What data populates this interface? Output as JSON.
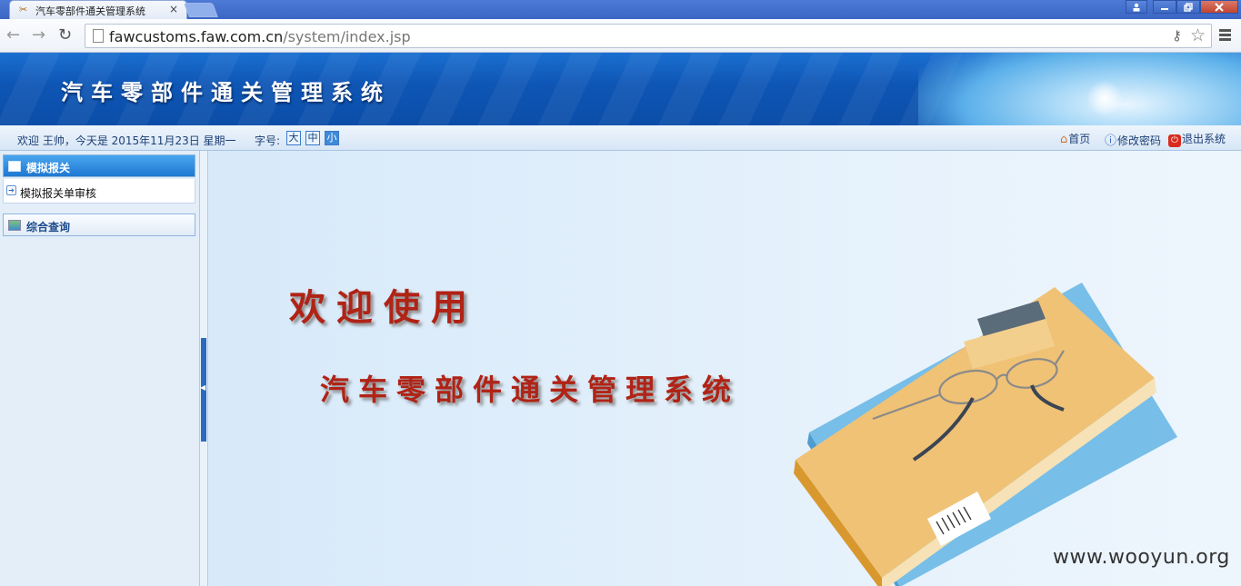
{
  "browser": {
    "tab_title": "汽车零部件通关管理系统",
    "tab_close": "×",
    "url_host": "fawcustoms.faw.com.cn",
    "url_path": "/system/index.jsp"
  },
  "app": {
    "banner_title": "汽车零部件通关管理系统",
    "welcome_text": "欢迎 王帅，今天是 2015年11月23日 星期一",
    "font_size_label": "字号:",
    "font_sizes": [
      "大",
      "中",
      "小"
    ],
    "selected_font_size": "小",
    "top_links": {
      "home": "首页",
      "change_password": "修改密码",
      "logout": "退出系统"
    }
  },
  "sidebar": {
    "menus": [
      {
        "title": "模拟报关",
        "expanded": true,
        "items": [
          "模拟报关单审核"
        ]
      },
      {
        "title": "综合查询",
        "expanded": false,
        "items": []
      }
    ]
  },
  "main": {
    "welcome_line1": "欢迎使用",
    "welcome_line2": "汽车零部件通关管理系统"
  },
  "watermark": "www.wooyun.org",
  "colors": {
    "banner": "#0e55b4",
    "accent_red": "#b02316",
    "sidebar_active": "#1e78d2"
  }
}
